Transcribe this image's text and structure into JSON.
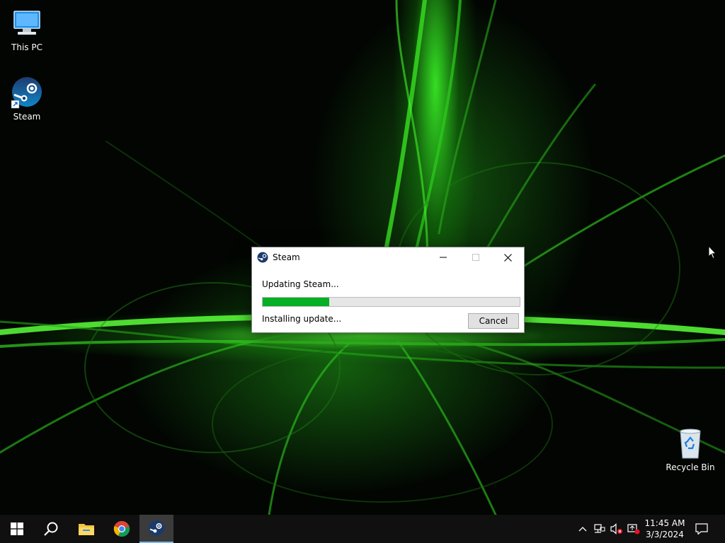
{
  "desktop": {
    "icons": [
      {
        "label": "This PC",
        "icon": "this-pc-icon"
      },
      {
        "label": "Steam",
        "icon": "steam-icon"
      },
      {
        "label": "Recycle Bin",
        "icon": "recycle-bin-icon"
      }
    ]
  },
  "dialog": {
    "title": "Steam",
    "status": "Updating Steam...",
    "progress_percent": 26,
    "detail": "Installing update...",
    "cancel_label": "Cancel",
    "title_icon": "steam-icon"
  },
  "taskbar": {
    "pinned": [
      {
        "name": "start-icon"
      },
      {
        "name": "search-icon"
      },
      {
        "name": "file-explorer-icon"
      },
      {
        "name": "chrome-icon"
      },
      {
        "name": "steam-icon",
        "active": true
      }
    ],
    "tray": [
      "chevron-up-icon",
      "network-icon",
      "volume-muted-icon",
      "notification-badge-icon"
    ],
    "time": "11:45 AM",
    "date": "3/3/2024"
  },
  "colors": {
    "progress": "#06b025",
    "taskbar": "#101010",
    "wallpaper_glow": "#3cff28"
  }
}
